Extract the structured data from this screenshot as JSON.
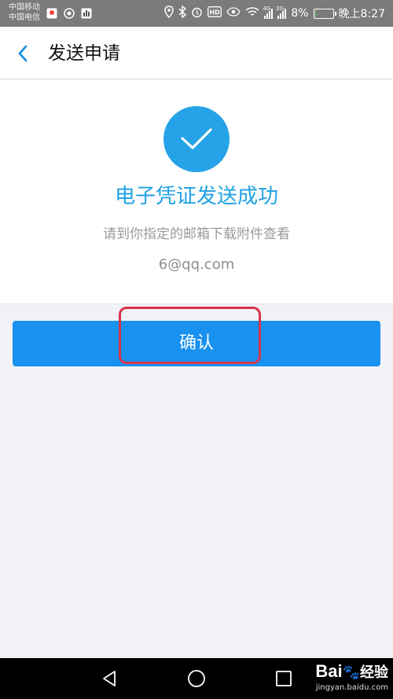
{
  "status_bar": {
    "carrier_1": "中国移动",
    "carrier_2": "中国电信",
    "battery_percent": "8%",
    "time": "晚上8:27",
    "network_1": "4G",
    "network_2": "2G",
    "icons_left": [
      "map-pin-app-icon",
      "app-icon",
      "chart-app-icon"
    ],
    "icons_right": [
      "location-icon",
      "bluetooth-icon",
      "alarm-icon",
      "hd-icon",
      "eye-icon",
      "wifi-icon",
      "signal-icon",
      "signal-icon",
      "battery-icon"
    ],
    "battery_level": 0.08
  },
  "header": {
    "title": "发送申请",
    "back_icon": "chevron-left-icon"
  },
  "result": {
    "icon": "checkmark-icon",
    "title": "电子凭证发送成功",
    "subtitle": "请到你指定的邮箱下载附件查看",
    "email": "6@qq.com"
  },
  "actions": {
    "confirm_label": "确认"
  },
  "nav_bar": {
    "icons": [
      "back-triangle-icon",
      "home-circle-icon",
      "recent-square-icon"
    ]
  },
  "watermark": {
    "brand": "Bai",
    "brand_suffix": "经验",
    "url": "jingyan.baidu.com"
  },
  "colors": {
    "accent": "#1891ef",
    "title_blue": "#1ea2e3",
    "check_circle": "#26a3e8",
    "highlight": "#d8344a",
    "status_bar": "#7b7b7b"
  }
}
